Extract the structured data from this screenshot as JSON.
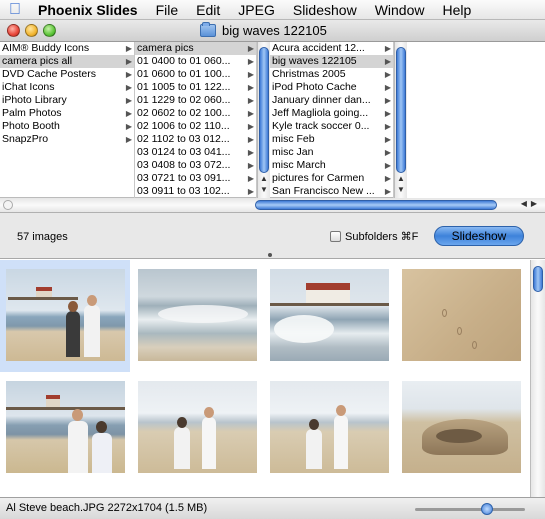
{
  "menubar": {
    "app_name": "Phoenix Slides",
    "items": [
      "File",
      "Edit",
      "JPEG",
      "Slideshow",
      "Window",
      "Help"
    ]
  },
  "window": {
    "title": "big waves 122105"
  },
  "browser": {
    "columns": [
      {
        "items": [
          {
            "label": "AIM® Buddy Icons",
            "selected": false
          },
          {
            "label": "camera pics all",
            "selected": true
          },
          {
            "label": "DVD Cache Posters",
            "selected": false
          },
          {
            "label": "iChat Icons",
            "selected": false
          },
          {
            "label": "iPhoto Library",
            "selected": false
          },
          {
            "label": "Palm Photos",
            "selected": false
          },
          {
            "label": "Photo Booth",
            "selected": false
          },
          {
            "label": "SnapzPro",
            "selected": false
          }
        ]
      },
      {
        "items": [
          {
            "label": "camera pics",
            "selected": true
          },
          {
            "label": "01 0400 to 01 060...",
            "selected": false
          },
          {
            "label": "01 0600 to 01 100...",
            "selected": false
          },
          {
            "label": "01 1005 to 01 122...",
            "selected": false
          },
          {
            "label": "01 1229 to 02 060...",
            "selected": false
          },
          {
            "label": "02 0602 to 02 100...",
            "selected": false
          },
          {
            "label": "02 1006 to 02 110...",
            "selected": false
          },
          {
            "label": "02 1102 to 03 012...",
            "selected": false
          },
          {
            "label": "03 0124 to 03 041...",
            "selected": false
          },
          {
            "label": "03 0408 to 03 072...",
            "selected": false
          },
          {
            "label": "03 0721 to 03 091...",
            "selected": false
          },
          {
            "label": "03 0911 to 03 102...",
            "selected": false
          }
        ]
      },
      {
        "items": [
          {
            "label": "Acura accident 12...",
            "selected": false
          },
          {
            "label": "big waves 122105",
            "selected": true
          },
          {
            "label": "Christmas 2005",
            "selected": false
          },
          {
            "label": "iPod Photo Cache",
            "selected": false
          },
          {
            "label": "January dinner dan...",
            "selected": false
          },
          {
            "label": "Jeff Magliola going...",
            "selected": false
          },
          {
            "label": "Kyle track soccer 0...",
            "selected": false
          },
          {
            "label": "misc Feb",
            "selected": false
          },
          {
            "label": "misc Jan",
            "selected": false
          },
          {
            "label": "misc March",
            "selected": false
          },
          {
            "label": "pictures for Carmen",
            "selected": false
          },
          {
            "label": "San Francisco New ...",
            "selected": false
          }
        ]
      }
    ]
  },
  "toolbar": {
    "count_label": "57 images",
    "subfolders_label": "Subfolders ⌘F",
    "subfolders_checked": false,
    "slideshow_label": "Slideshow"
  },
  "thumbnails": [
    {
      "scene": "pier-couple",
      "selected": true
    },
    {
      "scene": "waves",
      "selected": false
    },
    {
      "scene": "pier-waves",
      "selected": false
    },
    {
      "scene": "sand-footprints",
      "selected": false
    },
    {
      "scene": "pier-two-people",
      "selected": false
    },
    {
      "scene": "beach-two-people",
      "selected": false
    },
    {
      "scene": "beach-two-people-2",
      "selected": false
    },
    {
      "scene": "sand-dune",
      "selected": false
    }
  ],
  "status": {
    "text": "Al Steve beach.JPG 2272x1704 (1.5 MB)",
    "zoom_level": 0.65
  },
  "colors": {
    "selection_blue": "#3d82da",
    "selected_cell": "#cfe0f8",
    "light_red": "#e8463a",
    "light_yellow": "#f2b632",
    "light_green": "#5ec63a"
  }
}
